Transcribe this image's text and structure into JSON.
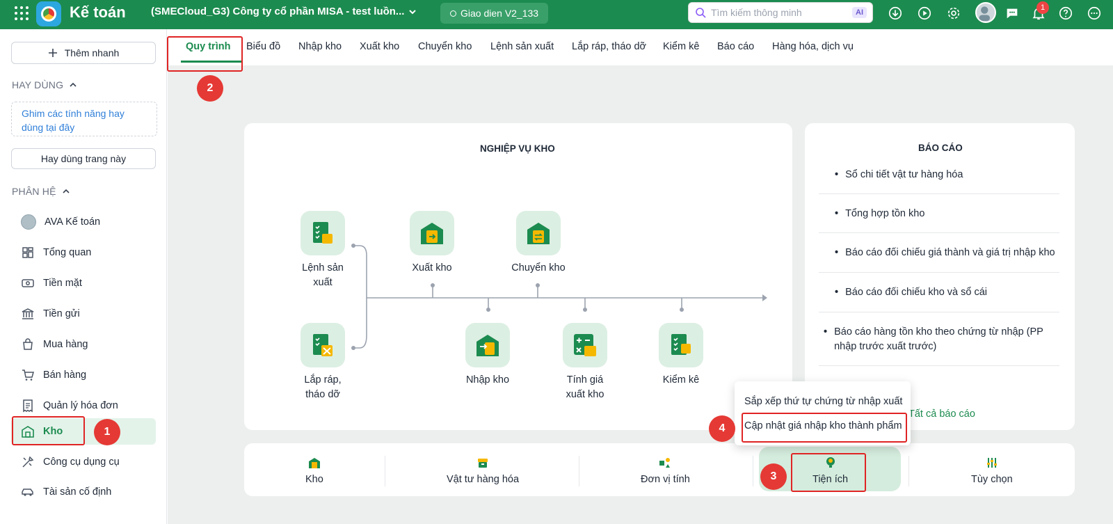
{
  "topbar": {
    "app_name": "Kế toán",
    "company": "(SMECloud_G3) Công ty cổ phần MISA - test luồn...",
    "version": "Giao dien V2_133",
    "search_placeholder": "Tìm kiếm thông minh",
    "ai_label": "AI",
    "notification_count": "1",
    "icons": [
      "apps-grid-icon",
      "download-icon",
      "play-icon",
      "gear-icon",
      "avatar",
      "chat-icon",
      "bell-icon",
      "help-icon",
      "more-icon"
    ]
  },
  "sidebar": {
    "quick_add": "Thêm nhanh",
    "favorites_heading": "HAY DÙNG",
    "pin_hint": "Ghim các tính năng hay dùng tại đây",
    "favorites_button": "Hay dùng trang này",
    "modules_heading": "PHÂN HỆ",
    "items": [
      {
        "label": "AVA Kế toán",
        "icon": "avatar"
      },
      {
        "label": "Tổng quan",
        "icon": "dashboard-icon"
      },
      {
        "label": "Tiền mặt",
        "icon": "cash-icon"
      },
      {
        "label": "Tiền gửi",
        "icon": "bank-icon"
      },
      {
        "label": "Mua hàng",
        "icon": "shopping-bag-icon"
      },
      {
        "label": "Bán hàng",
        "icon": "cart-icon"
      },
      {
        "label": "Quản lý hóa đơn",
        "icon": "invoice-icon"
      },
      {
        "label": "Kho",
        "icon": "warehouse-icon",
        "active": true
      },
      {
        "label": "Công cụ dụng cụ",
        "icon": "tools-icon"
      },
      {
        "label": "Tài sản cố định",
        "icon": "car-icon"
      }
    ]
  },
  "tabs": [
    "Quy trình",
    "Biểu đồ",
    "Nhập kho",
    "Xuất kho",
    "Chuyển kho",
    "Lệnh sản xuất",
    "Lắp ráp, tháo dỡ",
    "Kiểm kê",
    "Báo cáo",
    "Hàng hóa, dịch vụ"
  ],
  "active_tab": "Quy trình",
  "process": {
    "title": "NGHIỆP VỤ KHO",
    "nodes": {
      "lenh_san_xuat_1": "Lệnh sản",
      "lenh_san_xuat_2": "xuất",
      "xuat_kho": "Xuất kho",
      "chuyen_kho": "Chuyển kho",
      "lap_rap_1": "Lắp ráp,",
      "lap_rap_2": "tháo dỡ",
      "nhap_kho": "Nhập kho",
      "tinh_gia_1": "Tính giá",
      "tinh_gia_2": "xuất kho",
      "kiem_ke": "Kiểm kê"
    }
  },
  "reports": {
    "title": "BÁO CÁO",
    "items": [
      "Sổ chi tiết vật tư hàng hóa",
      "Tổng hợp tồn kho",
      "Báo cáo đối chiếu giá thành và giá trị nhập kho",
      "Báo cáo đối chiếu kho và sổ cái",
      "Báo cáo hàng tồn kho theo chứng từ nhập (PP nhập trước xuất trước)"
    ],
    "all_link": "Tất cả báo cáo"
  },
  "popup": {
    "items": [
      "Sắp xếp thứ tự chứng từ nhập xuất",
      "Cập nhật giá nhập kho thành phẩm"
    ]
  },
  "bottom": {
    "items": [
      "Kho",
      "Vật tư hàng hóa",
      "Đơn vị tính",
      "Tiện ích",
      "Tùy chọn"
    ]
  },
  "annotations": {
    "steps": [
      "1",
      "2",
      "3",
      "4"
    ]
  },
  "colors": {
    "brand": "#1c8b4f",
    "accent_light": "#dcefe3",
    "callout": "#e53935",
    "icon_yellow": "#f5b800"
  }
}
